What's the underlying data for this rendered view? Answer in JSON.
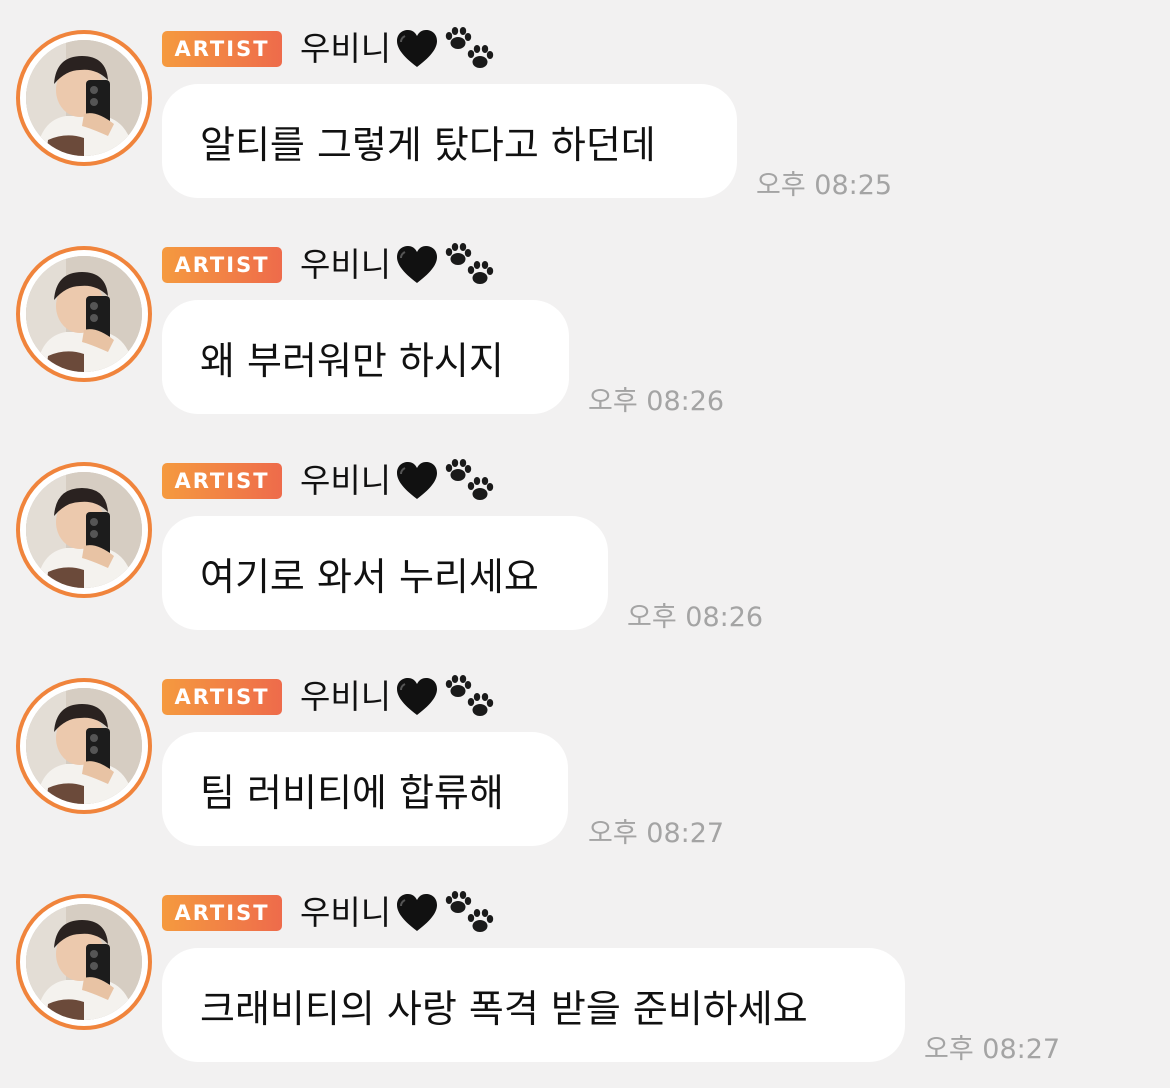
{
  "messages": [
    {
      "badge": "ARTIST",
      "sender": "우비니",
      "text": "알티를 그렇게 탔다고 하던데",
      "time": "오후 08:25"
    },
    {
      "badge": "ARTIST",
      "sender": "우비니",
      "text": "왜 부러워만 하시지",
      "time": "오후 08:26"
    },
    {
      "badge": "ARTIST",
      "sender": "우비니",
      "text": "여기로 와서 누리세요",
      "time": "오후 08:26"
    },
    {
      "badge": "ARTIST",
      "sender": "우비니",
      "text": "팀 러비티에 합류해",
      "time": "오후 08:27"
    },
    {
      "badge": "ARTIST",
      "sender": "우비니",
      "text": "크래비티의 사랑 폭격 받을 준비하세요",
      "time": "오후 08:27"
    }
  ],
  "icons": {
    "heart": "black-heart-icon",
    "paw": "paw-prints-icon"
  },
  "colors": {
    "background": "#f2f1f1",
    "badge_start": "#f59a3f",
    "badge_end": "#ee6b4b",
    "avatar_ring": "#f0843c",
    "bubble": "#ffffff",
    "time_text": "#a4a4a4"
  }
}
